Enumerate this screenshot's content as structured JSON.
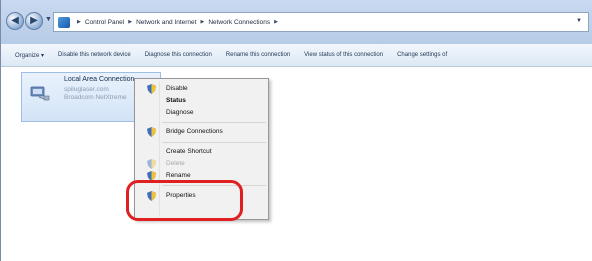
{
  "address_bar": {
    "crumbs": [
      "Control Panel",
      "Network and Internet",
      "Network Connections"
    ],
    "icons": {
      "back": "back-arrow-icon",
      "forward": "forward-arrow-icon"
    }
  },
  "toolbar": {
    "items": [
      "Organize ▾",
      "Disable this network device",
      "Diagnose this connection",
      "Rename this connection",
      "View status of this connection",
      "Change settings of"
    ]
  },
  "connection": {
    "name": "Local Area Connection",
    "network": "spiluglaser.com",
    "adapter": "Broadcom NetXtreme"
  },
  "context_menu": {
    "items": [
      {
        "label": "Disable",
        "icon": "shield-icon"
      },
      {
        "label": "Status"
      },
      {
        "label": "Diagnose"
      },
      {
        "label": "Bridge Connections",
        "icon": "shield-icon"
      },
      {
        "label": "Create Shortcut"
      },
      {
        "label": "Delete",
        "icon": "shield-icon"
      },
      {
        "label": "Rename",
        "icon": "shield-icon"
      },
      {
        "label": "Properties",
        "icon": "shield-icon"
      }
    ]
  },
  "colors": {
    "highlight": "#e02020",
    "accent": "#9ebee4"
  }
}
